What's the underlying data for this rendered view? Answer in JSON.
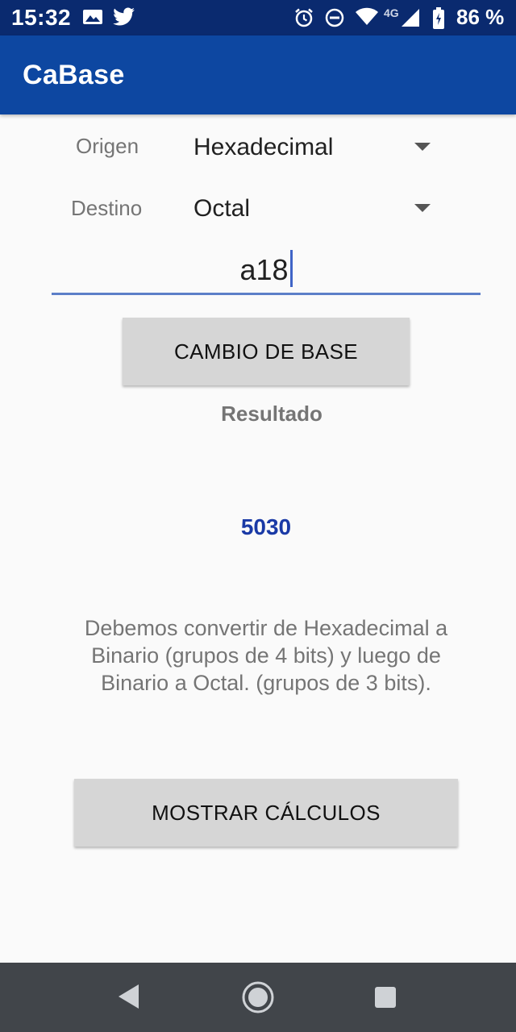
{
  "status_bar": {
    "time": "15:32",
    "network": "4G",
    "battery": "86 %",
    "icons": [
      "image-notification-icon",
      "twitter-icon",
      "alarm-icon",
      "do-not-disturb-icon",
      "wifi-icon",
      "signal-icon",
      "battery-icon"
    ]
  },
  "app_bar": {
    "title": "CaBase"
  },
  "form": {
    "origin_label": "Origen",
    "origin_value": "Hexadecimal",
    "destination_label": "Destino",
    "destination_value": "Octal",
    "input_value": "a18",
    "convert_button": "CAMBIO DE BASE"
  },
  "result": {
    "label": "Resultado",
    "value": "5030"
  },
  "explanation": {
    "lines": [
      "Debemos convertir de Hexadecimal a",
      "Binario (grupos de 4 bits) y luego de",
      "Binario a Octal. (grupos de 3 bits)."
    ]
  },
  "show_calc_button": "MOSTRAR CÁLCULOS",
  "nav_bar": {
    "icons": [
      "back-icon",
      "home-icon",
      "recents-icon"
    ]
  },
  "colors": {
    "status_bar": "#0a2a6f",
    "app_bar": "#0d47a1",
    "accent": "#3f64c7",
    "result": "#1a3aa6",
    "button": "#d6d6d6",
    "nav_bar": "#41454a"
  }
}
